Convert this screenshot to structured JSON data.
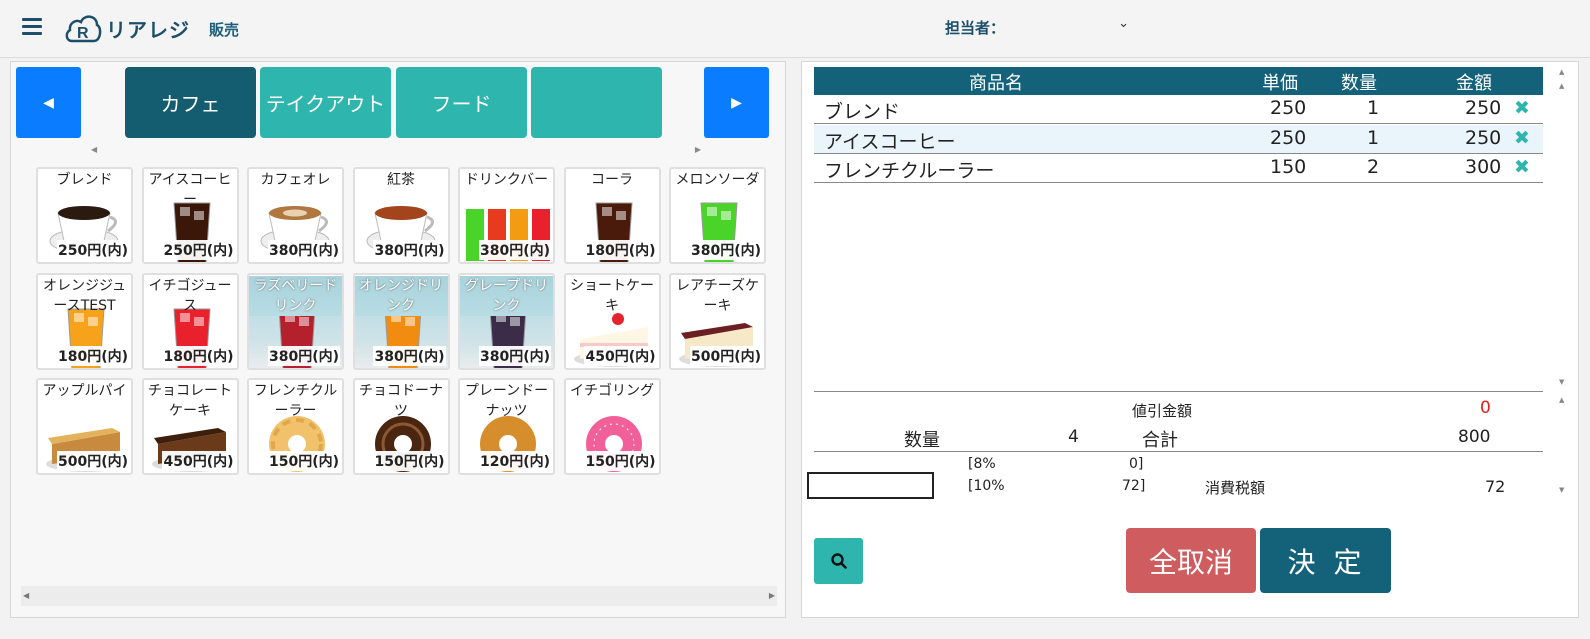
{
  "header": {
    "logo_text": "リアレジ",
    "nav_sales": "販売",
    "staff_label": "担当者：",
    "staff_value": ""
  },
  "categories": {
    "tabs": [
      {
        "label": "カフェ",
        "active": true
      },
      {
        "label": "テイクアウト",
        "active": false
      },
      {
        "label": "フード",
        "active": false
      },
      {
        "label": "",
        "active": false
      }
    ]
  },
  "products": [
    {
      "name": "ブレンド",
      "price": "250円(内)",
      "img": "coffee"
    },
    {
      "name": "アイスコーヒー",
      "price": "250円(内)",
      "img": "iced-coffee"
    },
    {
      "name": "カフェオレ",
      "price": "380円(内)",
      "img": "latte"
    },
    {
      "name": "紅茶",
      "price": "380円(内)",
      "img": "tea"
    },
    {
      "name": "ドリンクバー",
      "price": "380円(内)",
      "img": "drinkbar"
    },
    {
      "name": "コーラ",
      "price": "180円(内)",
      "img": "cola"
    },
    {
      "name": "メロンソーダ",
      "price": "380円(内)",
      "img": "melon"
    },
    {
      "name": "オレンジジュースTEST",
      "price": "180円(内)",
      "img": "orange-juice"
    },
    {
      "name": "イチゴジュース",
      "price": "180円(内)",
      "img": "strawberry-juice"
    },
    {
      "name": "ラズベリードリンク",
      "price": "380円(内)",
      "img": "raspberry"
    },
    {
      "name": "オレンジドリンク",
      "price": "380円(内)",
      "img": "orange-drink"
    },
    {
      "name": "グレープドリンク",
      "price": "380円(内)",
      "img": "grape"
    },
    {
      "name": "ショートケーキ",
      "price": "450円(内)",
      "img": "shortcake"
    },
    {
      "name": "レアチーズケーキ",
      "price": "500円(内)",
      "img": "cheesecake"
    },
    {
      "name": "アップルパイ",
      "price": "500円(内)",
      "img": "applepie"
    },
    {
      "name": "チョコレートケーキ",
      "price": "450円(内)",
      "img": "chococake"
    },
    {
      "name": "フレンチクルーラー",
      "price": "150円(内)",
      "img": "cruller"
    },
    {
      "name": "チョコドーナツ",
      "price": "150円(内)",
      "img": "choco-donut"
    },
    {
      "name": "プレーンドーナッツ",
      "price": "120円(内)",
      "img": "plain-donut"
    },
    {
      "name": "イチゴリング",
      "price": "150円(内)",
      "img": "strawberry-ring"
    }
  ],
  "cart": {
    "headers": {
      "name": "商品名",
      "unit": "単価",
      "qty": "数量",
      "amount": "金額"
    },
    "rows": [
      {
        "name": "ブレンド",
        "unit": "250",
        "qty": "1",
        "amount": "250"
      },
      {
        "name": "アイスコーヒー",
        "unit": "250",
        "qty": "1",
        "amount": "250"
      },
      {
        "name": "フレンチクルーラー",
        "unit": "150",
        "qty": "2",
        "amount": "300"
      }
    ],
    "delete_symbol": "✖"
  },
  "summary": {
    "discount_label": "値引金額",
    "discount_value": "0",
    "qty_label": "数量",
    "qty_value": "4",
    "total_label": "合計",
    "total_value": "800",
    "tax8_label": "[8%",
    "tax8_value": "0]",
    "tax10_label": "[10%",
    "tax10_value": "72]",
    "tax_label": "消費税額",
    "tax_value": "72"
  },
  "buttons": {
    "cancel_all": "全取消",
    "confirm": "決定"
  },
  "colors": {
    "teal": "#2eb5ad",
    "dark_teal": "#145d71",
    "blue": "#0a7cff",
    "red": "#cf5c5f"
  }
}
